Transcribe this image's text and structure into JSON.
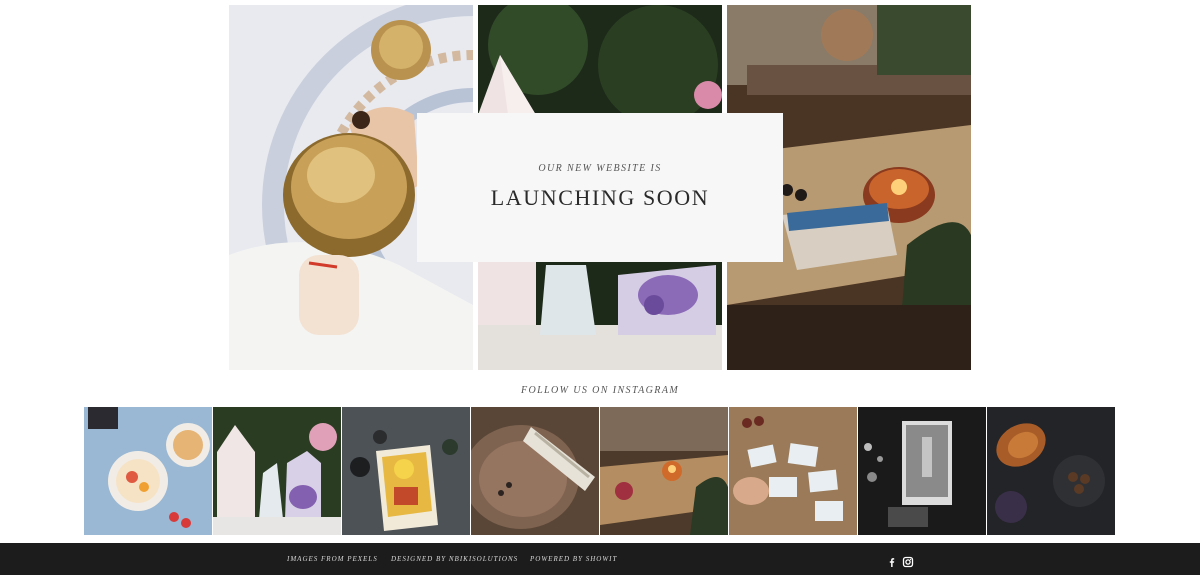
{
  "hero": {
    "images": [
      {
        "name": "singing-bowl-photo"
      },
      {
        "name": "crystals-photo"
      },
      {
        "name": "candle-tarot-photo"
      }
    ],
    "card": {
      "eyebrow": "OUR NEW WEBSITE IS",
      "title": "LAUNCHING SOON"
    }
  },
  "instagram": {
    "heading": "FOLLOW US ON INSTAGRAM",
    "tiles": [
      {
        "name": "breakfast-bowls-photo"
      },
      {
        "name": "crystal-points-photo"
      },
      {
        "name": "sun-tarot-card-photo"
      },
      {
        "name": "sage-bundle-photo"
      },
      {
        "name": "candles-table-photo"
      },
      {
        "name": "tarot-spread-photo"
      },
      {
        "name": "hanged-man-card-photo"
      },
      {
        "name": "croissant-photo"
      }
    ]
  },
  "footer": {
    "links": {
      "pexels": "IMAGES FROM PEXELS",
      "designer": "DESIGNED BY NBIKISOLUTIONS",
      "showit": "POWERED BY SHOWIT"
    },
    "social": [
      {
        "icon": "facebook-icon",
        "glyph": "f"
      },
      {
        "icon": "instagram-icon"
      }
    ]
  },
  "colors": {
    "card_background": "#f7f7f7",
    "footer_background": "#1c1c1c",
    "footer_text": "#d8d8d8"
  }
}
